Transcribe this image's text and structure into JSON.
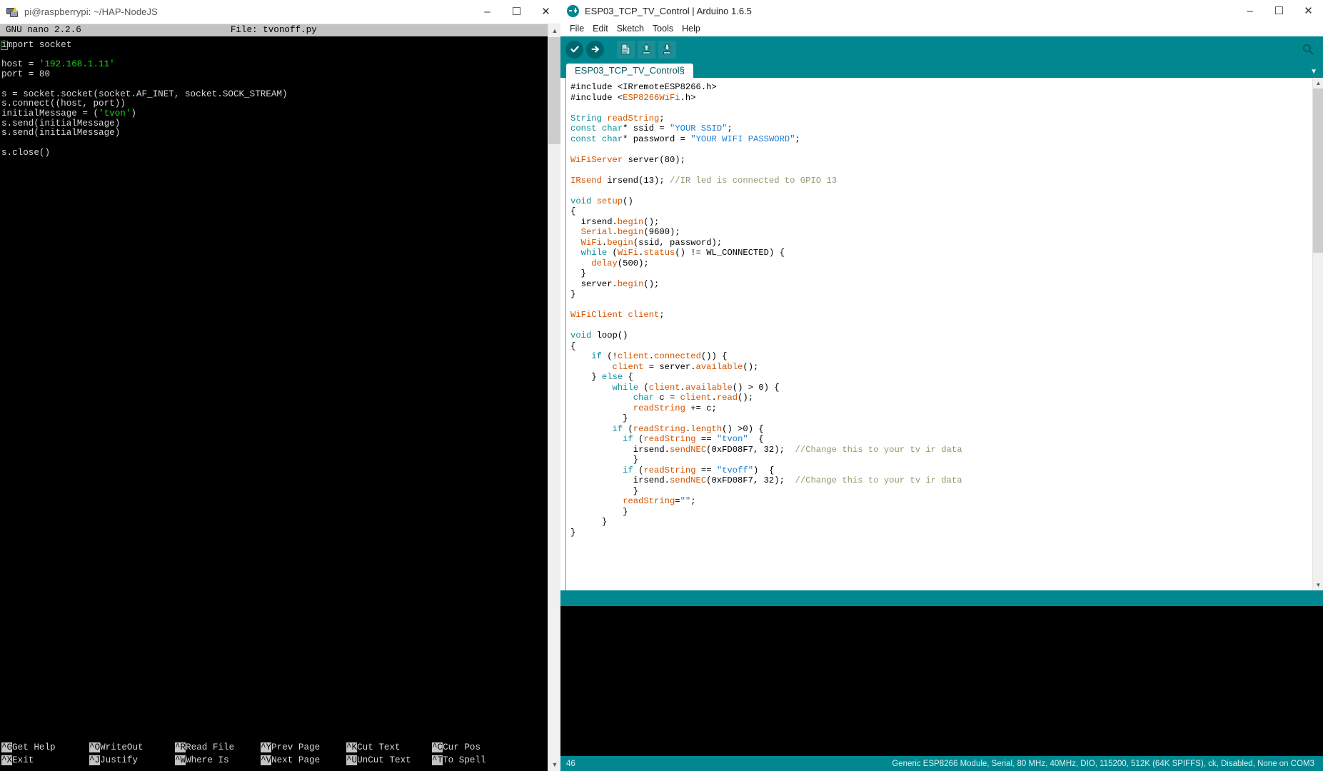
{
  "nano_window": {
    "titlebar": {
      "title": "pi@raspberrypi: ~/HAP-NodeJS",
      "icon": "putty-terminal-icon",
      "minimize": "–",
      "maximize": "☐",
      "close": "✕"
    },
    "header": {
      "app": "  GNU nano 2.2.6",
      "file": "File: tvonoff.py"
    },
    "code_lines": [
      "import socket",
      "",
      "host = '192.168.1.11'",
      "port = 80",
      "",
      "s = socket.socket(socket.AF_INET, socket.SOCK_STREAM)",
      "s.connect((host, port))",
      "initialMessage = ('tvon')",
      "s.send(initialMessage)",
      "s.send(initialMessage)",
      "",
      "s.close()"
    ],
    "code_plain": {
      "l1_rest": "mport socket",
      "cursor_char": "i",
      "host_label": "host = ",
      "host_value": "'192.168.1.11'",
      "port_line": "port = 80",
      "socket_line": "s = socket.socket(socket.AF_INET, socket.SOCK_STREAM)",
      "connect_line": "s.connect((host, port))",
      "msg_label": "initialMessage = (",
      "msg_value": "'tvon'",
      "msg_close": ")",
      "send_line_1": "s.send(initialMessage)",
      "send_line_2": "s.send(initialMessage)",
      "close_line": "s.close()"
    },
    "shortcuts": [
      {
        "key": "^G",
        "label": "Get Help",
        "key2": "^X",
        "label2": "Exit"
      },
      {
        "key": "^O",
        "label": "WriteOut",
        "key2": "^J",
        "label2": "Justify"
      },
      {
        "key": "^R",
        "label": "Read File",
        "key2": "^W",
        "label2": "Where Is"
      },
      {
        "key": "^Y",
        "label": "Prev Page",
        "key2": "^V",
        "label2": "Next Page"
      },
      {
        "key": "^K",
        "label": "Cut Text",
        "key2": "^U",
        "label2": "UnCut Text"
      },
      {
        "key": "^C",
        "label": "Cur Pos",
        "key2": "^T",
        "label2": "To Spell"
      }
    ],
    "scrollbar": {
      "up": "▲",
      "down": "▼"
    }
  },
  "arduino_window": {
    "titlebar": {
      "title": "ESP03_TCP_TV_Control | Arduino 1.6.5",
      "logo": "arduino-infinity-logo",
      "minimize": "–",
      "maximize": "☐",
      "close": "✕"
    },
    "menu": [
      "File",
      "Edit",
      "Sketch",
      "Tools",
      "Help"
    ],
    "toolbar": {
      "verify": "verify-check-icon",
      "upload": "upload-arrow-icon",
      "new": "new-sketch-icon",
      "open": "open-sketch-icon",
      "save": "save-sketch-icon",
      "serial_monitor": "serial-monitor-icon"
    },
    "tab": {
      "label": "ESP03_TCP_TV_Control§"
    },
    "tab_arrow": "▼",
    "code": [
      [
        {
          "t": "#include <IRremoteESP8266.h>",
          "c": "num"
        }
      ],
      [
        {
          "t": "#include <",
          "c": "num"
        },
        {
          "t": "ESP8266WiFi",
          "c": "fn"
        },
        {
          "t": ".h>",
          "c": "num"
        }
      ],
      [
        {
          "t": "",
          "c": "num"
        }
      ],
      [
        {
          "t": "String",
          "c": "kw"
        },
        {
          "t": " ",
          "c": "num"
        },
        {
          "t": "readString",
          "c": "fn"
        },
        {
          "t": ";",
          "c": "num"
        }
      ],
      [
        {
          "t": "const",
          "c": "kw"
        },
        {
          "t": " ",
          "c": "num"
        },
        {
          "t": "char",
          "c": "kw"
        },
        {
          "t": "* ssid = ",
          "c": "num"
        },
        {
          "t": "\"YOUR SSID\"",
          "c": "str"
        },
        {
          "t": ";",
          "c": "num"
        }
      ],
      [
        {
          "t": "const",
          "c": "kw"
        },
        {
          "t": " ",
          "c": "num"
        },
        {
          "t": "char",
          "c": "kw"
        },
        {
          "t": "* password = ",
          "c": "num"
        },
        {
          "t": "\"YOUR WIFI PASSWORD\"",
          "c": "str"
        },
        {
          "t": ";",
          "c": "num"
        }
      ],
      [
        {
          "t": "",
          "c": "num"
        }
      ],
      [
        {
          "t": "WiFiServer",
          "c": "fn"
        },
        {
          "t": " server(80);",
          "c": "num"
        }
      ],
      [
        {
          "t": "",
          "c": "num"
        }
      ],
      [
        {
          "t": "IRsend",
          "c": "fn"
        },
        {
          "t": " irsend(13); ",
          "c": "num"
        },
        {
          "t": "//IR led is connected to GPIO 13",
          "c": "cm"
        }
      ],
      [
        {
          "t": "",
          "c": "num"
        }
      ],
      [
        {
          "t": "void",
          "c": "kw"
        },
        {
          "t": " ",
          "c": "num"
        },
        {
          "t": "setup",
          "c": "fn"
        },
        {
          "t": "()",
          "c": "num"
        }
      ],
      [
        {
          "t": "{",
          "c": "num"
        }
      ],
      [
        {
          "t": "  irsend.",
          "c": "num"
        },
        {
          "t": "begin",
          "c": "fn"
        },
        {
          "t": "();",
          "c": "num"
        }
      ],
      [
        {
          "t": "  ",
          "c": "num"
        },
        {
          "t": "Serial",
          "c": "fn"
        },
        {
          "t": ".",
          "c": "num"
        },
        {
          "t": "begin",
          "c": "fn"
        },
        {
          "t": "(9600);",
          "c": "num"
        }
      ],
      [
        {
          "t": "  ",
          "c": "num"
        },
        {
          "t": "WiFi",
          "c": "fn"
        },
        {
          "t": ".",
          "c": "num"
        },
        {
          "t": "begin",
          "c": "fn"
        },
        {
          "t": "(ssid, password);",
          "c": "num"
        }
      ],
      [
        {
          "t": "  ",
          "c": "num"
        },
        {
          "t": "while",
          "c": "kw"
        },
        {
          "t": " (",
          "c": "num"
        },
        {
          "t": "WiFi",
          "c": "fn"
        },
        {
          "t": ".",
          "c": "num"
        },
        {
          "t": "status",
          "c": "fn"
        },
        {
          "t": "() != WL_CONNECTED) {",
          "c": "num"
        }
      ],
      [
        {
          "t": "    ",
          "c": "num"
        },
        {
          "t": "delay",
          "c": "fn"
        },
        {
          "t": "(500);",
          "c": "num"
        }
      ],
      [
        {
          "t": "  }",
          "c": "num"
        }
      ],
      [
        {
          "t": "  server.",
          "c": "num"
        },
        {
          "t": "begin",
          "c": "fn"
        },
        {
          "t": "();",
          "c": "num"
        }
      ],
      [
        {
          "t": "}",
          "c": "num"
        }
      ],
      [
        {
          "t": "",
          "c": "num"
        }
      ],
      [
        {
          "t": "WiFiClient",
          "c": "fn"
        },
        {
          "t": " ",
          "c": "num"
        },
        {
          "t": "client",
          "c": "fn"
        },
        {
          "t": ";",
          "c": "num"
        }
      ],
      [
        {
          "t": "",
          "c": "num"
        }
      ],
      [
        {
          "t": "void",
          "c": "kw"
        },
        {
          "t": " loop()",
          "c": "num"
        }
      ],
      [
        {
          "t": "{",
          "c": "num"
        }
      ],
      [
        {
          "t": "    ",
          "c": "num"
        },
        {
          "t": "if",
          "c": "kw"
        },
        {
          "t": " (!",
          "c": "num"
        },
        {
          "t": "client",
          "c": "fn"
        },
        {
          "t": ".",
          "c": "num"
        },
        {
          "t": "connected",
          "c": "fn"
        },
        {
          "t": "()) {",
          "c": "num"
        }
      ],
      [
        {
          "t": "        ",
          "c": "num"
        },
        {
          "t": "client",
          "c": "fn"
        },
        {
          "t": " = server.",
          "c": "num"
        },
        {
          "t": "available",
          "c": "fn"
        },
        {
          "t": "();",
          "c": "num"
        }
      ],
      [
        {
          "t": "    } ",
          "c": "num"
        },
        {
          "t": "else",
          "c": "kw"
        },
        {
          "t": " {",
          "c": "num"
        }
      ],
      [
        {
          "t": "        ",
          "c": "num"
        },
        {
          "t": "while",
          "c": "kw"
        },
        {
          "t": " (",
          "c": "num"
        },
        {
          "t": "client",
          "c": "fn"
        },
        {
          "t": ".",
          "c": "num"
        },
        {
          "t": "available",
          "c": "fn"
        },
        {
          "t": "() > 0) {",
          "c": "num"
        }
      ],
      [
        {
          "t": "            ",
          "c": "num"
        },
        {
          "t": "char",
          "c": "kw"
        },
        {
          "t": " c = ",
          "c": "num"
        },
        {
          "t": "client",
          "c": "fn"
        },
        {
          "t": ".",
          "c": "num"
        },
        {
          "t": "read",
          "c": "fn"
        },
        {
          "t": "();",
          "c": "num"
        }
      ],
      [
        {
          "t": "            ",
          "c": "num"
        },
        {
          "t": "readString",
          "c": "fn"
        },
        {
          "t": " += c;",
          "c": "num"
        }
      ],
      [
        {
          "t": "          }",
          "c": "num"
        }
      ],
      [
        {
          "t": "        ",
          "c": "num"
        },
        {
          "t": "if",
          "c": "kw"
        },
        {
          "t": " (",
          "c": "num"
        },
        {
          "t": "readString",
          "c": "fn"
        },
        {
          "t": ".",
          "c": "num"
        },
        {
          "t": "length",
          "c": "fn"
        },
        {
          "t": "() >0) {",
          "c": "num"
        }
      ],
      [
        {
          "t": "          ",
          "c": "num"
        },
        {
          "t": "if",
          "c": "kw"
        },
        {
          "t": " (",
          "c": "num"
        },
        {
          "t": "readString",
          "c": "fn"
        },
        {
          "t": " == ",
          "c": "num"
        },
        {
          "t": "\"tvon\"",
          "c": "str"
        },
        {
          "t": "  {",
          "c": "num"
        }
      ],
      [
        {
          "t": "            irsend.",
          "c": "num"
        },
        {
          "t": "sendNEC",
          "c": "fn"
        },
        {
          "t": "(0xFD08F7, 32);  ",
          "c": "num"
        },
        {
          "t": "//Change this to your tv ir data",
          "c": "cm"
        }
      ],
      [
        {
          "t": "            }",
          "c": "num"
        }
      ],
      [
        {
          "t": "          ",
          "c": "num"
        },
        {
          "t": "if",
          "c": "kw"
        },
        {
          "t": " (",
          "c": "num"
        },
        {
          "t": "readString",
          "c": "fn"
        },
        {
          "t": " == ",
          "c": "num"
        },
        {
          "t": "\"tvoff\"",
          "c": "str"
        },
        {
          "t": ")  {",
          "c": "num"
        }
      ],
      [
        {
          "t": "            irsend.",
          "c": "num"
        },
        {
          "t": "sendNEC",
          "c": "fn"
        },
        {
          "t": "(0xFD08F7, 32);  ",
          "c": "num"
        },
        {
          "t": "//Change this to your tv ir data",
          "c": "cm"
        }
      ],
      [
        {
          "t": "            }",
          "c": "num"
        }
      ],
      [
        {
          "t": "          ",
          "c": "num"
        },
        {
          "t": "readString",
          "c": "fn"
        },
        {
          "t": "=",
          "c": "num"
        },
        {
          "t": "\"\"",
          "c": "str"
        },
        {
          "t": ";",
          "c": "num"
        }
      ],
      [
        {
          "t": "          }",
          "c": "num"
        }
      ],
      [
        {
          "t": "      }",
          "c": "num"
        }
      ],
      [
        {
          "t": "}",
          "c": "num"
        }
      ]
    ],
    "status": {
      "line_number": "46",
      "board_info": "Generic ESP8266 Module, Serial, 80 MHz, 40MHz, DIO, 115200, 512K (64K SPIFFS), ck, Disabled, None on COM3"
    },
    "scrollbar": {
      "up": "▲",
      "down": "▼"
    }
  },
  "colors": {
    "arduino_teal": "#00878f",
    "arduino_teal_dark": "#00666d",
    "keyword_teal": "#0b8f96",
    "function_orange": "#d35400",
    "string_blue": "#1a7fd4",
    "comment_olive": "#8f9a6b",
    "nano_header_gray": "#c3c3c3",
    "terminal_green": "#18d718"
  }
}
